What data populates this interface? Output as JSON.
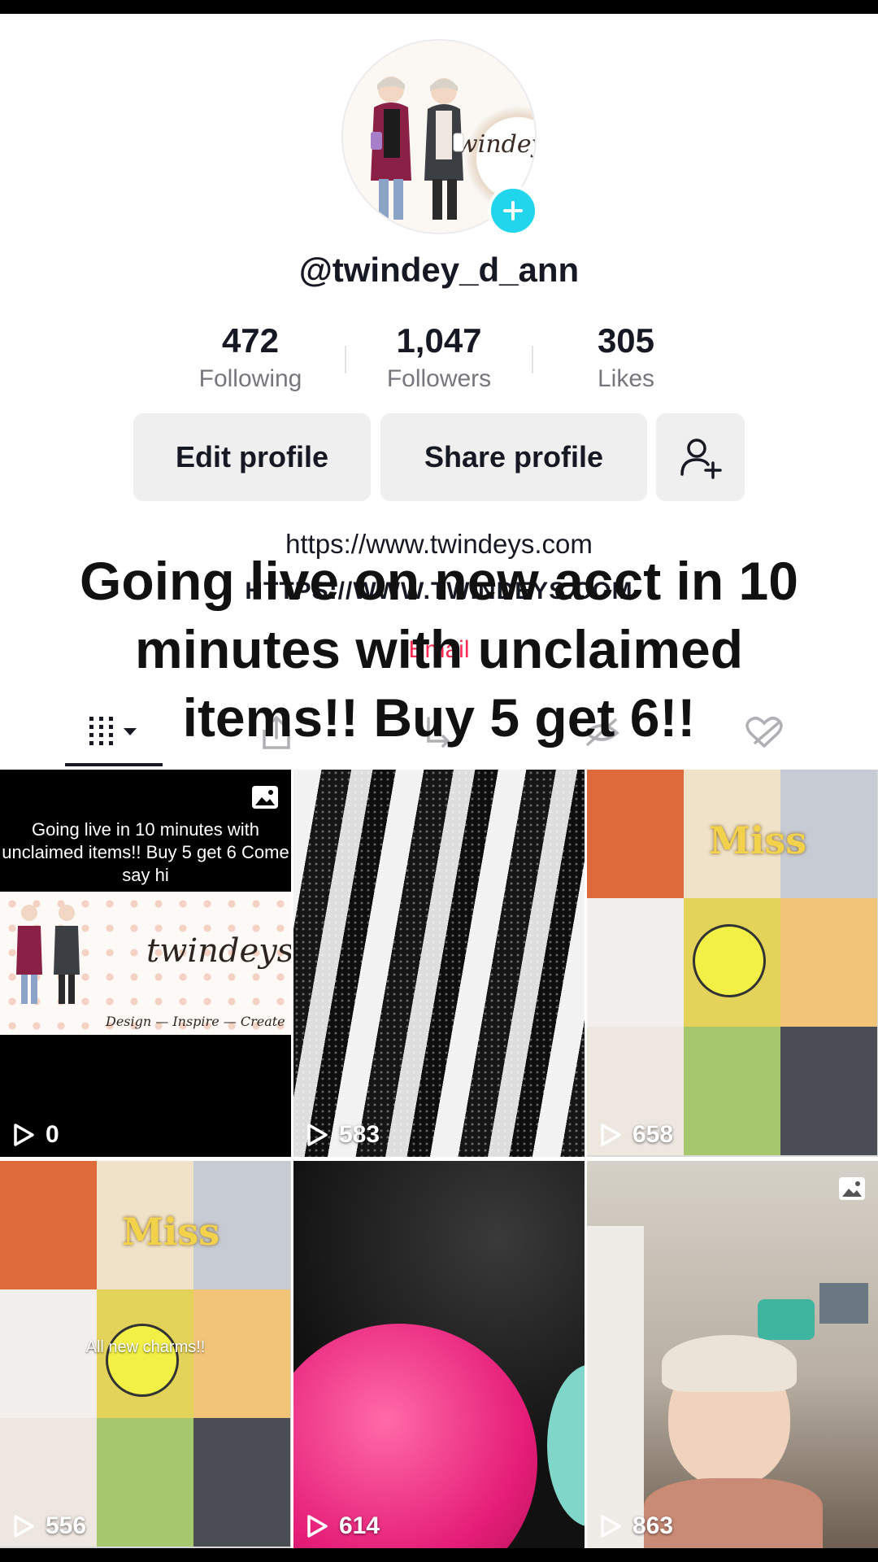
{
  "profile": {
    "avatar_brand": "twindeys",
    "username": "@twindey_d_ann"
  },
  "stats": [
    {
      "value": "472",
      "label": "Following"
    },
    {
      "value": "1,047",
      "label": "Followers"
    },
    {
      "value": "305",
      "label": "Likes"
    }
  ],
  "buttons": {
    "edit_profile": "Edit profile",
    "share_profile": "Share profile"
  },
  "bio": {
    "link": "https://www.twindeys.com",
    "ghost_link": "HTTPS://WWW.TWINDEYS.COM",
    "ghost_email": "Email"
  },
  "overlay_caption": "Going live on new acct in 10 minutes with unclaimed items!! Buy 5 get 6!!",
  "tabs": [
    {
      "icon": "grid-icon",
      "selected": true
    },
    {
      "icon": "share-icon"
    },
    {
      "icon": "repost-icon"
    },
    {
      "icon": "hidden-icon"
    },
    {
      "icon": "liked-hidden-icon"
    }
  ],
  "videos": [
    {
      "views": "0",
      "caption": "Going live in 10 minutes with unclaimed items!! Buy 5 get 6 Come say hi",
      "brand": "twindeys",
      "tagline": "Design — Inspire — Create",
      "is_photo": true
    },
    {
      "views": "583"
    },
    {
      "views": "658",
      "thumb_text": "Miss"
    },
    {
      "views": "556",
      "thumb_text": "Miss",
      "overlay_text": "All new charms!!"
    },
    {
      "views": "614"
    },
    {
      "views": "863",
      "is_photo": true
    }
  ],
  "colors": {
    "accent_cyan": "#20d5ec",
    "email_red": "#fe2c55",
    "text_primary": "#161823",
    "text_secondary": "#76777d",
    "button_bg": "#efeff0"
  }
}
